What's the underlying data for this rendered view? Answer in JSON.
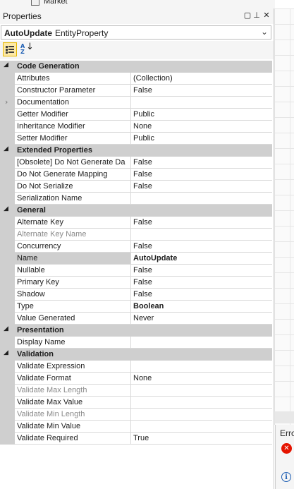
{
  "top_strip": {
    "text": "Market"
  },
  "panel": {
    "title": "Properties",
    "buttons": {
      "dropdown": "▢",
      "pin": "⊥",
      "close": "✕"
    }
  },
  "object_selector": {
    "name": "AutoUpdate",
    "type": "EntityProperty",
    "chevron": "⌄"
  },
  "toolbar": {
    "alpha_a": "A",
    "alpha_z": "Z",
    "alpha_arrow": "↓"
  },
  "categories": [
    {
      "label": "Code Generation",
      "toggle": "◢",
      "properties": [
        {
          "name": "Attributes",
          "value": "(Collection)"
        },
        {
          "name": "Constructor Parameter",
          "value": "False"
        },
        {
          "name": "Documentation",
          "value": "",
          "expandable": true
        },
        {
          "name": "Getter Modifier",
          "value": "Public"
        },
        {
          "name": "Inheritance Modifier",
          "value": "None"
        },
        {
          "name": "Setter Modifier",
          "value": "Public"
        }
      ]
    },
    {
      "label": "Extended Properties",
      "toggle": "◢",
      "properties": [
        {
          "name": "[Obsolete] Do Not Generate Da",
          "value": "False"
        },
        {
          "name": "Do Not Generate Mapping",
          "value": "False"
        },
        {
          "name": "Do Not Serialize",
          "value": "False"
        },
        {
          "name": "Serialization Name",
          "value": ""
        }
      ]
    },
    {
      "label": "General",
      "toggle": "◢",
      "properties": [
        {
          "name": "Alternate Key",
          "value": "False"
        },
        {
          "name": "Alternate Key Name",
          "value": "",
          "disabled": true
        },
        {
          "name": "Concurrency",
          "value": "False"
        },
        {
          "name": "Name",
          "value": "AutoUpdate",
          "bold": true,
          "selected": true
        },
        {
          "name": "Nullable",
          "value": "False"
        },
        {
          "name": "Primary Key",
          "value": "False"
        },
        {
          "name": "Shadow",
          "value": "False"
        },
        {
          "name": "Type",
          "value": "Boolean",
          "bold": true
        },
        {
          "name": "Value Generated",
          "value": "Never"
        }
      ]
    },
    {
      "label": "Presentation",
      "toggle": "◢",
      "properties": [
        {
          "name": "Display Name",
          "value": ""
        }
      ]
    },
    {
      "label": "Validation",
      "toggle": "◢",
      "properties": [
        {
          "name": "Validate Expression",
          "value": ""
        },
        {
          "name": "Validate Format",
          "value": "None"
        },
        {
          "name": "Validate Max Length",
          "value": "",
          "disabled": true
        },
        {
          "name": "Validate Max Value",
          "value": ""
        },
        {
          "name": "Validate Min Length",
          "value": "",
          "disabled": true
        },
        {
          "name": "Validate Min Value",
          "value": ""
        },
        {
          "name": "Validate Required",
          "value": "True"
        }
      ]
    }
  ],
  "error_panel": {
    "title": "Erro",
    "error_glyph": "✕",
    "info_glyph": "i"
  },
  "colors": {
    "category_bg": "#cfcfcf",
    "selection": "#cfcfcf",
    "error_red": "#e51400",
    "info_blue": "#1e5fb4"
  }
}
